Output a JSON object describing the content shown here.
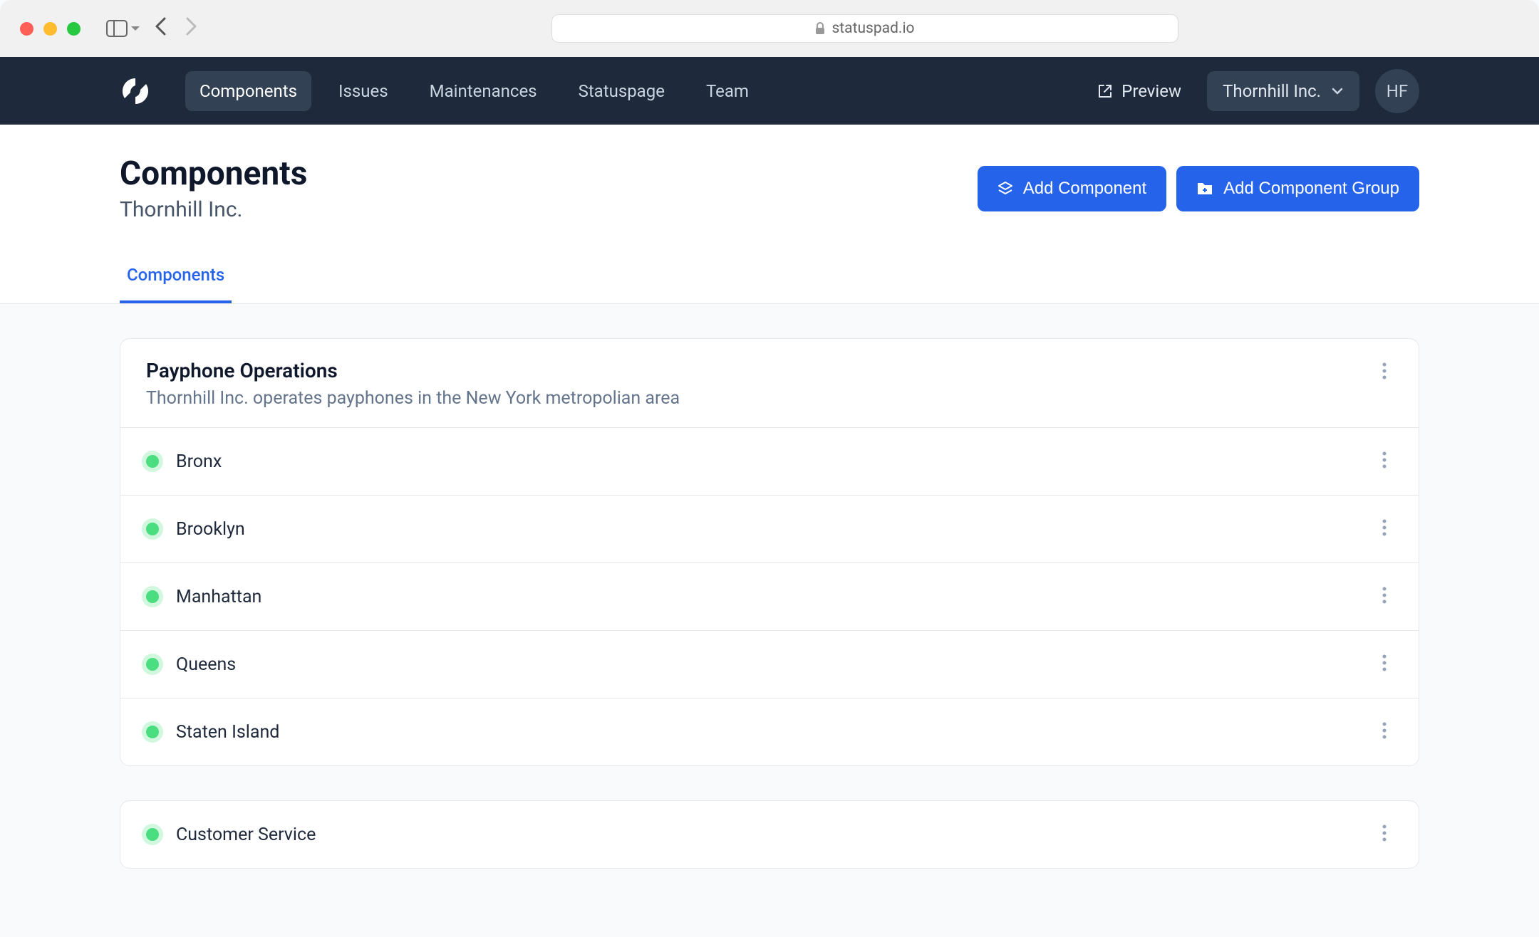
{
  "browser": {
    "url": "statuspad.io"
  },
  "nav": {
    "items": [
      {
        "label": "Components",
        "active": true
      },
      {
        "label": "Issues",
        "active": false
      },
      {
        "label": "Maintenances",
        "active": false
      },
      {
        "label": "Statuspage",
        "active": false
      },
      {
        "label": "Team",
        "active": false
      }
    ],
    "preview_label": "Preview",
    "org_name": "Thornhill Inc.",
    "avatar_initials": "HF"
  },
  "page": {
    "title": "Components",
    "subtitle": "Thornhill Inc.",
    "add_component_label": "Add Component",
    "add_group_label": "Add Component Group",
    "tab_label": "Components"
  },
  "groups": [
    {
      "title": "Payphone Operations",
      "description": "Thornhill Inc. operates payphones in the New York metropolian area",
      "components": [
        {
          "name": "Bronx",
          "status": "operational"
        },
        {
          "name": "Brooklyn",
          "status": "operational"
        },
        {
          "name": "Manhattan",
          "status": "operational"
        },
        {
          "name": "Queens",
          "status": "operational"
        },
        {
          "name": "Staten Island",
          "status": "operational"
        }
      ]
    }
  ],
  "standalone_components": [
    {
      "name": "Customer Service",
      "status": "operational"
    }
  ]
}
